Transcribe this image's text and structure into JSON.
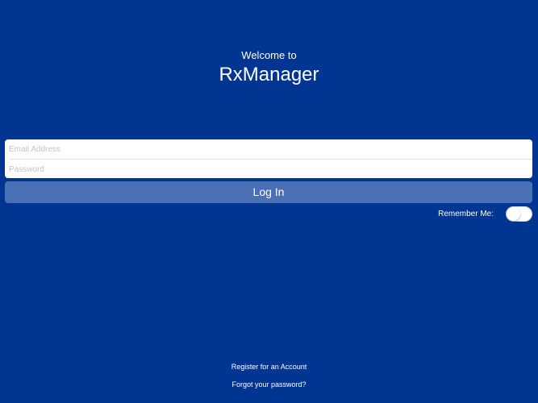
{
  "header": {
    "welcome_text": "Welcome to",
    "app_name": "RxManager"
  },
  "login_form": {
    "email_placeholder": "Email Address",
    "email_value": "",
    "password_placeholder": "Password",
    "password_value": "",
    "login_label": "Log In"
  },
  "remember_me": {
    "label": "Remember Me:",
    "enabled": false
  },
  "links": {
    "register": "Register for an Account",
    "forgot_password": "Forgot your password?"
  },
  "colors": {
    "background": "#003591",
    "button": "#4a70b6",
    "text": "#ffffff"
  }
}
